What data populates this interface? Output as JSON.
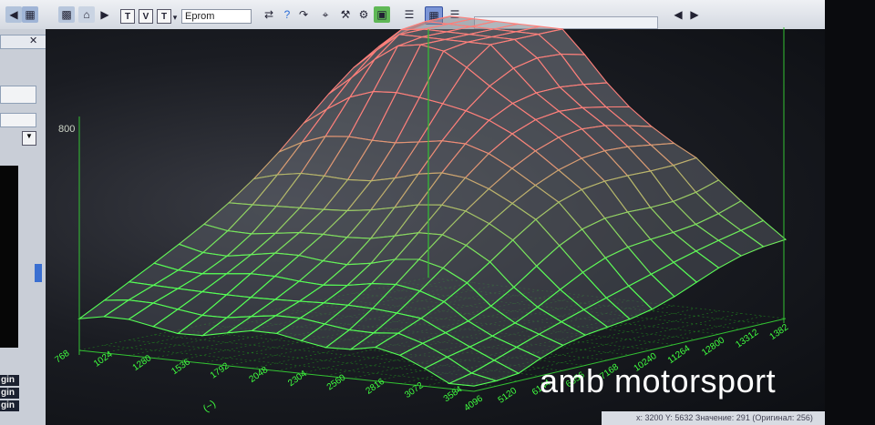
{
  "toolbar": {
    "box_labels": [
      "T",
      "V",
      "T"
    ],
    "eprom_field": "Eprom",
    "tools": [
      "nav-left-icon",
      "nav-right-icon",
      "tree-icon",
      "home-icon",
      "play-icon",
      "help-icon",
      "cursor-icon",
      "map-icon",
      "find-icon",
      "tools-icon",
      "compare-icon",
      "grid-icon",
      "select-icon",
      "nav-prev-icon",
      "nav-next-icon"
    ]
  },
  "left_panel": {
    "labels": [
      "gin",
      "gin",
      "gin"
    ]
  },
  "map": {
    "z_tick": "800",
    "x_ticks": [
      "768",
      "1024",
      "1280",
      "1536",
      "1792",
      "2048",
      "2304",
      "2560",
      "2816",
      "3072",
      "3584",
      "4096",
      "5120",
      "6144",
      "6656",
      "7168",
      "10240",
      "11264",
      "12800",
      "13312",
      "1382"
    ],
    "x_axis_unit": "(~)",
    "colors": {
      "high": "#ff7f7a",
      "low": "#55ff55",
      "axis": "#39d839"
    }
  },
  "watermark": "amb motorsport",
  "status": {
    "text": "x: 3200 Y: 5632 Значение: 291 (Оригинал: 256)"
  }
}
